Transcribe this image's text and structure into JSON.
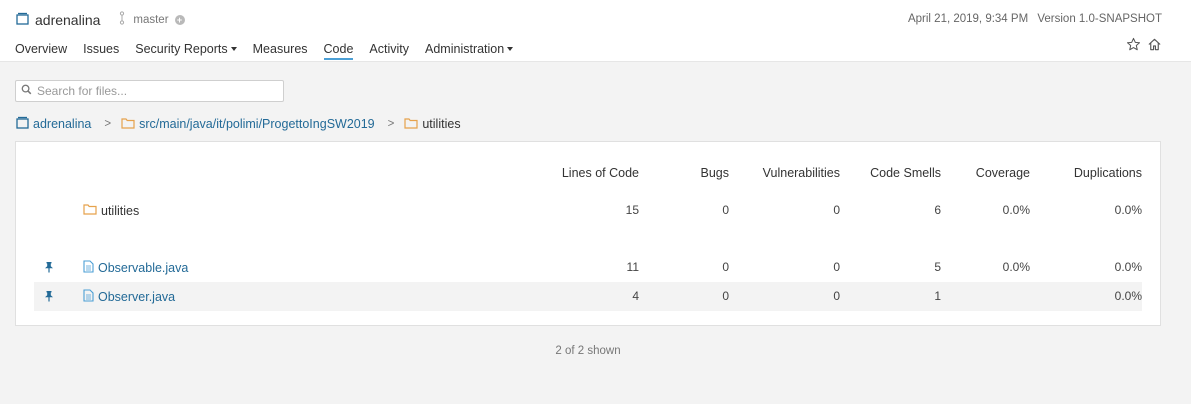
{
  "header": {
    "project_name": "adrenalina",
    "branch": "master",
    "date": "April 21, 2019, 9:34 PM",
    "version": "Version 1.0-SNAPSHOT"
  },
  "nav": {
    "tabs": [
      {
        "label": "Overview"
      },
      {
        "label": "Issues"
      },
      {
        "label": "Security Reports"
      },
      {
        "label": "Measures"
      },
      {
        "label": "Code"
      },
      {
        "label": "Activity"
      },
      {
        "label": "Administration"
      }
    ],
    "active_tab": "Code"
  },
  "search": {
    "placeholder": "Search for files..."
  },
  "breadcrumb": [
    {
      "label": "adrenalina",
      "icon": "project-icon"
    },
    {
      "label": "src/main/java/it/polimi/ProgettoIngSW2019",
      "icon": "folder-icon"
    },
    {
      "label": "utilities",
      "icon": "folder-icon"
    }
  ],
  "table": {
    "columns": [
      "Lines of Code",
      "Bugs",
      "Vulnerabilities",
      "Code Smells",
      "Coverage",
      "Duplications"
    ],
    "rows": [
      {
        "name": "utilities",
        "type": "directory",
        "loc": "15",
        "bugs": "0",
        "vulns": "0",
        "smells": "6",
        "coverage": "0.0%",
        "dup": "0.0%"
      },
      {
        "name": "Observable.java",
        "type": "file",
        "loc": "11",
        "bugs": "0",
        "vulns": "0",
        "smells": "5",
        "coverage": "0.0%",
        "dup": "0.0%"
      },
      {
        "name": "Observer.java",
        "type": "file",
        "loc": "4",
        "bugs": "0",
        "vulns": "0",
        "smells": "1",
        "coverage": "",
        "dup": "0.0%"
      }
    ]
  },
  "footer": {
    "shown_count": "2 of 2 shown"
  },
  "colors": {
    "link": "#236a97",
    "folder": "#e6a24c",
    "accent": "#4b9fd5",
    "pin": "#236a97"
  }
}
